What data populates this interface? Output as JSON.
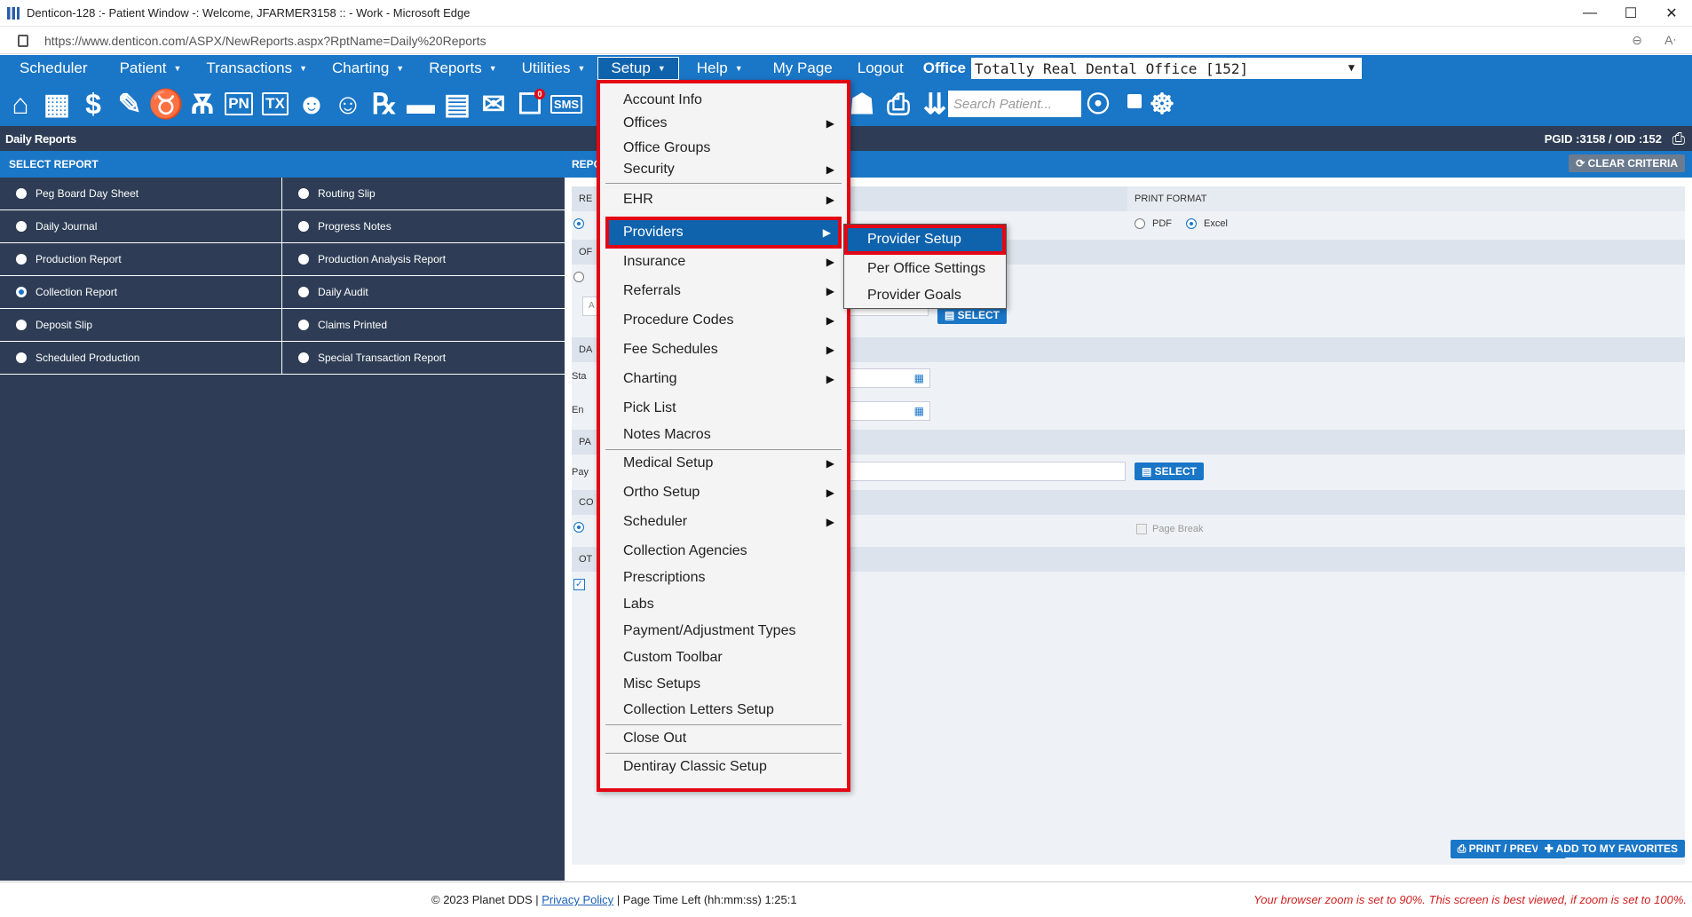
{
  "window": {
    "title": "Denticon-128 :- Patient Window -: Welcome, JFARMER3158 :: - Work - Microsoft Edge",
    "url": "https://www.denticon.com/ASPX/NewReports.aspx?RptName=Daily%20Reports",
    "controls": {
      "minimize": "—",
      "maximize": "☐",
      "close": "✕"
    }
  },
  "menubar": {
    "items": [
      {
        "label": "Scheduler",
        "caret": ""
      },
      {
        "label": "Patient",
        "caret": "▼"
      },
      {
        "label": "Transactions",
        "caret": "▼"
      },
      {
        "label": "Charting",
        "caret": "▼"
      },
      {
        "label": "Reports",
        "caret": "▼"
      },
      {
        "label": "Utilities",
        "caret": "▼"
      },
      {
        "label": "Setup",
        "caret": "▼"
      },
      {
        "label": "Help",
        "caret": "▼"
      },
      {
        "label": "My Page",
        "caret": ""
      },
      {
        "label": "Logout",
        "caret": ""
      }
    ],
    "office_label": "Office",
    "office_value": "Totally Real Dental Office [152]"
  },
  "toolbar": {
    "search_placeholder": "Search Patient...",
    "icons": [
      "home-icon",
      "calendar-icon",
      "dollar-icon",
      "edit-notes-icon",
      "tooth-icon",
      "tooth-chart-icon",
      "pn-icon",
      "tx-icon",
      "add-patient-icon",
      "patient-settings-icon",
      "rx-icon",
      "notes-icon",
      "print-form-icon",
      "email-icon",
      "message-icon",
      "sms-icon"
    ],
    "pn_label": "PN",
    "tx_label": "TX",
    "sms_label": "SMS",
    "message_badge": "0"
  },
  "pageheader": {
    "title": "Daily Reports",
    "ids": "PGID :3158  /  OID :152"
  },
  "leftpanel": {
    "header": "SELECT REPORT",
    "reports": [
      {
        "label": "Peg Board Day Sheet",
        "selected": false
      },
      {
        "label": "Routing Slip",
        "selected": false
      },
      {
        "label": "Daily Journal",
        "selected": false
      },
      {
        "label": "Progress Notes",
        "selected": false
      },
      {
        "label": "Production Report",
        "selected": false
      },
      {
        "label": "Production Analysis Report",
        "selected": false
      },
      {
        "label": "Collection Report",
        "selected": true
      },
      {
        "label": "Daily Audit",
        "selected": false
      },
      {
        "label": "Deposit Slip",
        "selected": false
      },
      {
        "label": "Claims Printed",
        "selected": false
      },
      {
        "label": "Scheduled Production",
        "selected": false
      },
      {
        "label": "Special Transaction Report",
        "selected": false
      }
    ]
  },
  "rightpanel": {
    "header": "REPO",
    "clear_criteria": "CLEAR CRITERIA",
    "print_format_label": "PRINT FORMAT",
    "pdf_label": "PDF",
    "excel_label": "Excel",
    "select_label": "SELECT",
    "page_break_label": "Page Break",
    "section_re": "RE",
    "section_of": "OF",
    "section_da": "DA",
    "section_pa": "PA",
    "section_co": "CO",
    "section_ot": "OT",
    "row_a": "A",
    "row_sta": "Sta",
    "row_en": "En",
    "row_pay": "Pay",
    "print_preview": "PRINT / PREVIEW",
    "add_favorites": "ADD TO MY FAVORITES"
  },
  "setup_menu": {
    "items": [
      {
        "label": "Account Info",
        "submenu": false
      },
      {
        "label": "Offices",
        "submenu": true
      },
      {
        "label": "Office Groups",
        "submenu": false
      },
      {
        "label": "Security",
        "submenu": true
      },
      {
        "label": "EHR",
        "submenu": true
      },
      {
        "label": "Providers",
        "submenu": true
      },
      {
        "label": "Insurance",
        "submenu": true
      },
      {
        "label": "Referrals",
        "submenu": true
      },
      {
        "label": "Procedure Codes",
        "submenu": true
      },
      {
        "label": "Fee Schedules",
        "submenu": true
      },
      {
        "label": "Charting",
        "submenu": true
      },
      {
        "label": "Pick List",
        "submenu": false
      },
      {
        "label": "Notes Macros",
        "submenu": false
      },
      {
        "label": "Medical Setup",
        "submenu": true
      },
      {
        "label": "Ortho Setup",
        "submenu": true
      },
      {
        "label": "Scheduler",
        "submenu": true
      },
      {
        "label": "Collection Agencies",
        "submenu": false
      },
      {
        "label": "Prescriptions",
        "submenu": false
      },
      {
        "label": "Labs",
        "submenu": false
      },
      {
        "label": "Payment/Adjustment Types",
        "submenu": false
      },
      {
        "label": "Custom Toolbar",
        "submenu": false
      },
      {
        "label": "Misc Setups",
        "submenu": false
      },
      {
        "label": "Collection Letters Setup",
        "submenu": false
      },
      {
        "label": "Close Out",
        "submenu": false
      },
      {
        "label": "Dentiray Classic Setup",
        "submenu": false
      }
    ],
    "arrow": "▶"
  },
  "providers_submenu": {
    "items": [
      "Provider Setup",
      "Per Office Settings",
      "Provider Goals"
    ]
  },
  "footer": {
    "copyright": "© 2023 Planet DDS |",
    "privacy": "Privacy Policy",
    "time_left": "| Page Time Left (hh:mm:ss) 1:25:1",
    "warning": "Your browser zoom is set to 90%. This screen is best viewed, if zoom is set to 100%."
  },
  "colors": {
    "brand_blue": "#1a76c6",
    "dark_navy": "#2e3d55",
    "highlight_red": "#e30613"
  }
}
